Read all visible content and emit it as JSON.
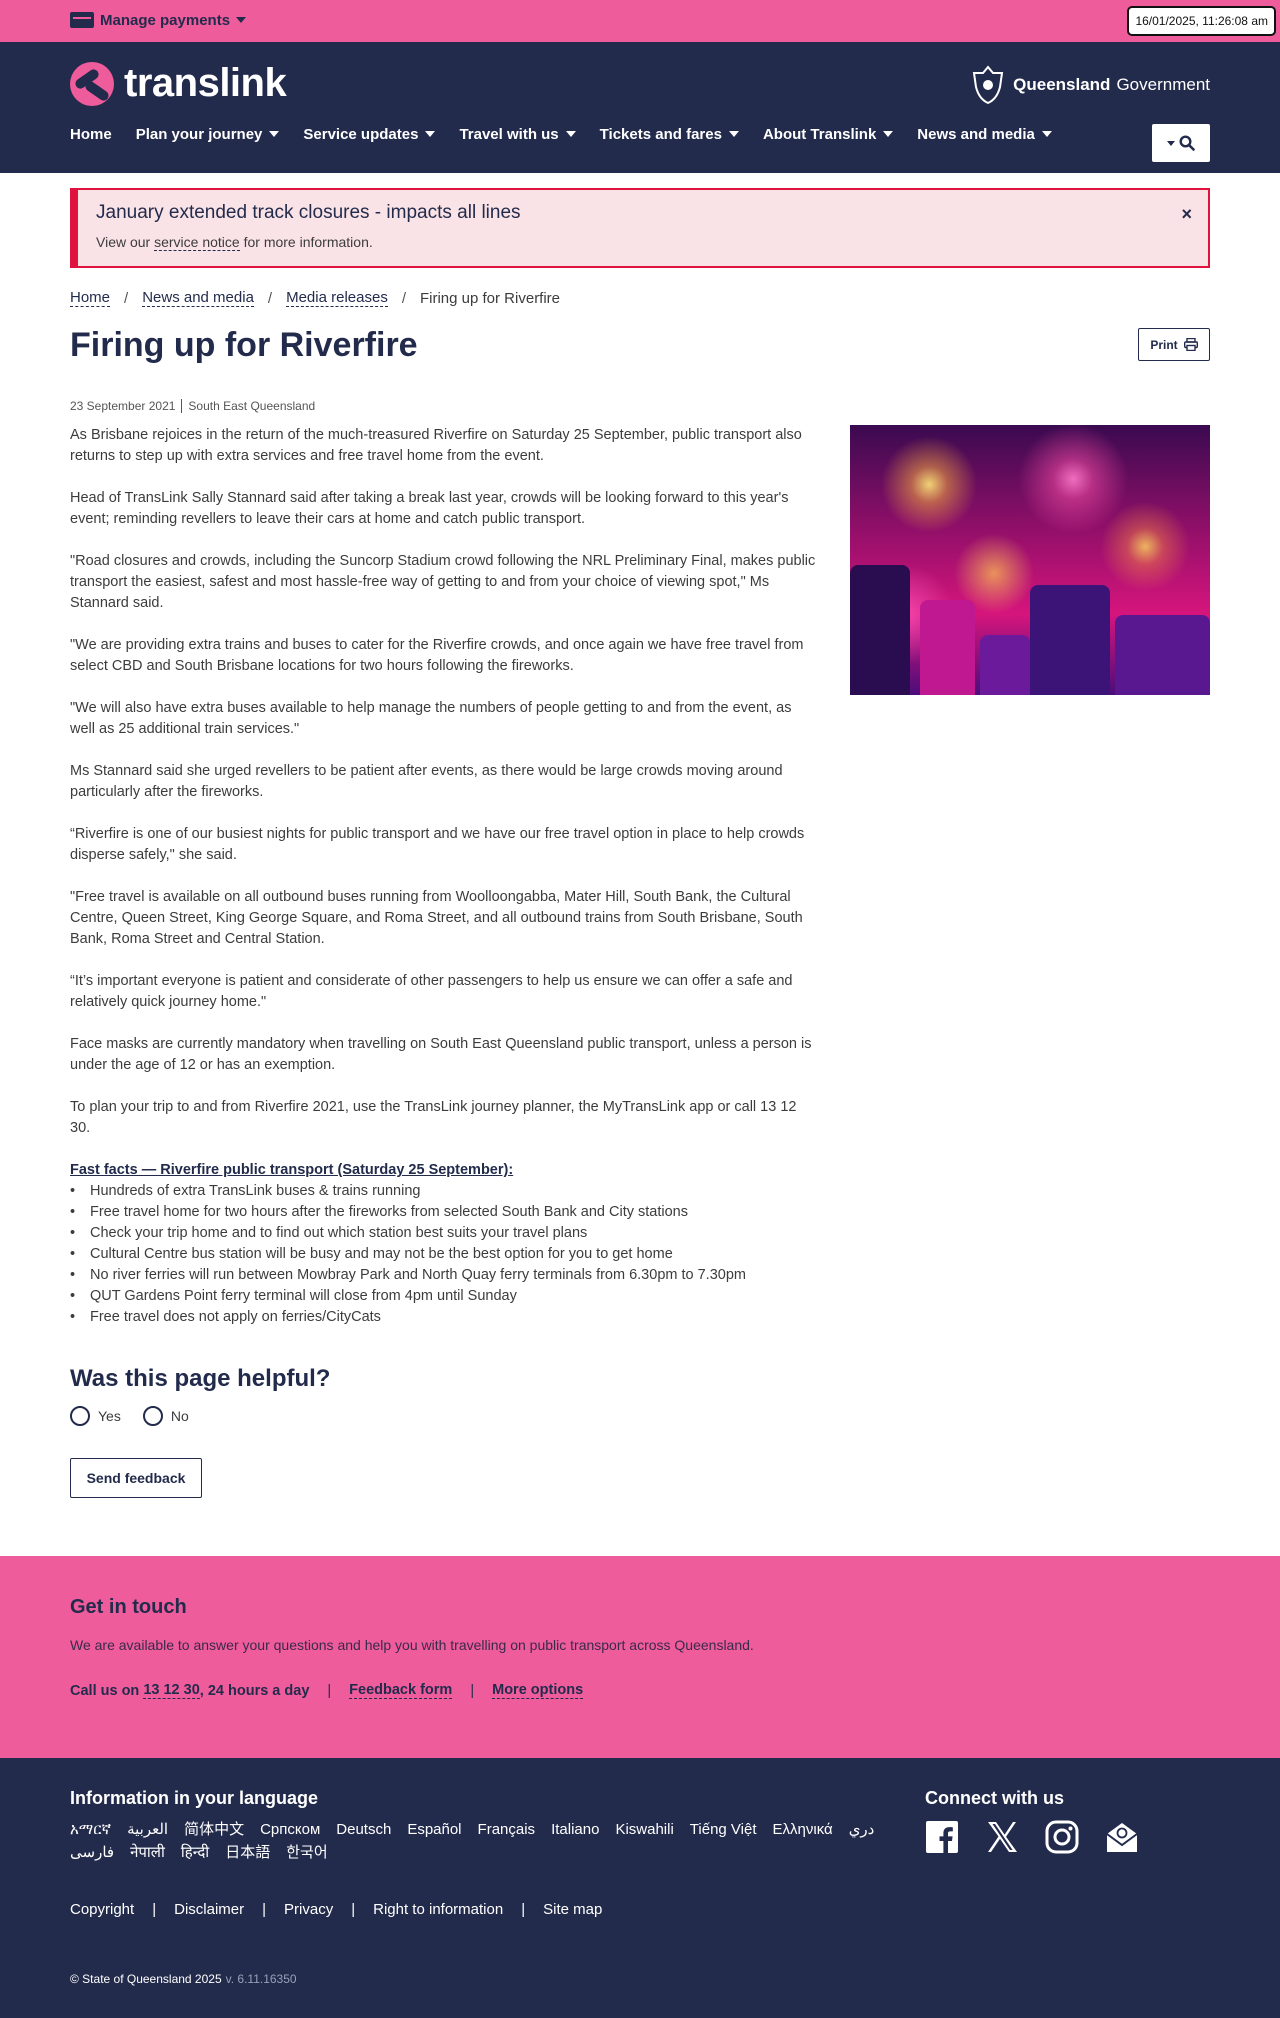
{
  "topbar": {
    "manage_payments": "Manage payments",
    "clock": "16/01/2025, 11:26:08 am"
  },
  "header": {
    "logo_text": "translink",
    "gov_bold": "Queensland",
    "gov_text": "Government",
    "nav": [
      {
        "label": "Home",
        "has_menu": false
      },
      {
        "label": "Plan your journey",
        "has_menu": true
      },
      {
        "label": "Service updates",
        "has_menu": true
      },
      {
        "label": "Travel with us",
        "has_menu": true
      },
      {
        "label": "Tickets and fares",
        "has_menu": true
      },
      {
        "label": "About Translink",
        "has_menu": true
      },
      {
        "label": "News and media",
        "has_menu": true
      }
    ]
  },
  "alert": {
    "title": "January extended track closures - impacts all lines",
    "body_prefix": "View our",
    "body_link": "service notice",
    "body_suffix": "for more information.",
    "close": "×"
  },
  "breadcrumb": {
    "items": [
      "Home",
      "News and media",
      "Media releases"
    ],
    "separator": "/",
    "current": "Firing up for Riverfire"
  },
  "article": {
    "title": "Firing up for Riverfire",
    "print_label": "Print",
    "date": "23 September 2021",
    "region": "South East Queensland",
    "paragraphs": [
      "As Brisbane rejoices in the return of the much-treasured Riverfire on Saturday 25 September, public transport also returns to step up with extra services and free travel home from the event.",
      "Head of TransLink Sally Stannard said after taking a break last year, crowds will be looking forward to this year's event; reminding revellers to leave their cars at home and catch public transport.",
      "\"Road closures and crowds, including the Suncorp Stadium crowd following the NRL Preliminary Final, makes public transport the easiest, safest and most hassle-free way of getting to and from your choice of viewing spot,\" Ms Stannard said.",
      "\"We are providing extra trains and buses to cater for the Riverfire crowds, and once again we have free travel from select CBD and South Brisbane locations for two hours following the fireworks.",
      "\"We will also have extra buses available to help manage the numbers of people getting to and from the event, as well as 25 additional train services.\"",
      "Ms Stannard said she urged revellers to be patient after events, as there would be large crowds moving around particularly after the fireworks.",
      "“Riverfire is one of our busiest nights for public transport and we have our free travel option in place to help crowds disperse safely,\" she said.",
      "\"Free travel is available on all outbound buses running from Woolloongabba, Mater Hill, South Bank, the Cultural Centre, Queen Street, King George Square, and Roma Street, and all outbound trains from South Brisbane, South Bank, Roma Street and Central Station.",
      "“It’s important everyone is patient and considerate of other passengers to help us ensure we can offer a safe and relatively quick journey home.\"",
      "Face masks are currently mandatory when travelling on South East Queensland public transport, unless a person is under the age of 12 or has an exemption.",
      "To plan your trip to and from Riverfire 2021, use the TransLink journey planner, the MyTransLink app or call 13 12 30."
    ],
    "facts_title": "Fast facts — Riverfire public transport (Saturday 25 September):",
    "facts": [
      "Hundreds of extra TransLink buses & trains running",
      "Free travel home for two hours after the fireworks from selected South Bank and City stations",
      "Check your trip home and to find out which station best suits your travel plans",
      "Cultural Centre bus station will be busy and may not be the best option for you to get home",
      "No river ferries will run between Mowbray Park and North Quay ferry terminals from 6.30pm to 7.30pm",
      "QUT Gardens Point ferry terminal will close from 4pm until Sunday",
      "Free travel does not apply on ferries/CityCats"
    ]
  },
  "feedback": {
    "title": "Was this page helpful?",
    "yes": "Yes",
    "no": "No",
    "send": "Send feedback"
  },
  "contact": {
    "title": "Get in touch",
    "description": "We are available to answer your questions and help you with travelling on public transport across Queensland.",
    "call_prefix": "Call us on",
    "phone": "13 12 30",
    "call_suffix": ", 24 hours a day",
    "feedback_form": "Feedback form",
    "more_options": "More options",
    "pipe": "|"
  },
  "footer": {
    "lang_title": "Information in your language",
    "languages": [
      "አማርኛ",
      "العربية",
      "简体中文",
      "Српском",
      "Deutsch",
      "Español",
      "Français",
      "Italiano",
      "Kiswahili",
      "Tiếng Việt",
      "Ελληνικά",
      "دري",
      "فارسی",
      "नेपाली",
      "हिन्दी",
      "日本語",
      "한국어"
    ],
    "connect_title": "Connect with us",
    "social": [
      "facebook-icon",
      "x-icon",
      "instagram-icon",
      "email-icon"
    ],
    "legal": [
      "Copyright",
      "Disclaimer",
      "Privacy",
      "Right to information",
      "Site map"
    ],
    "copyright": "© State of Queensland 2025",
    "version": "v. 6.11.16350"
  },
  "colors": {
    "pink": "#ef5c9c",
    "navy": "#232b4c",
    "alert_red": "#e0133e"
  }
}
